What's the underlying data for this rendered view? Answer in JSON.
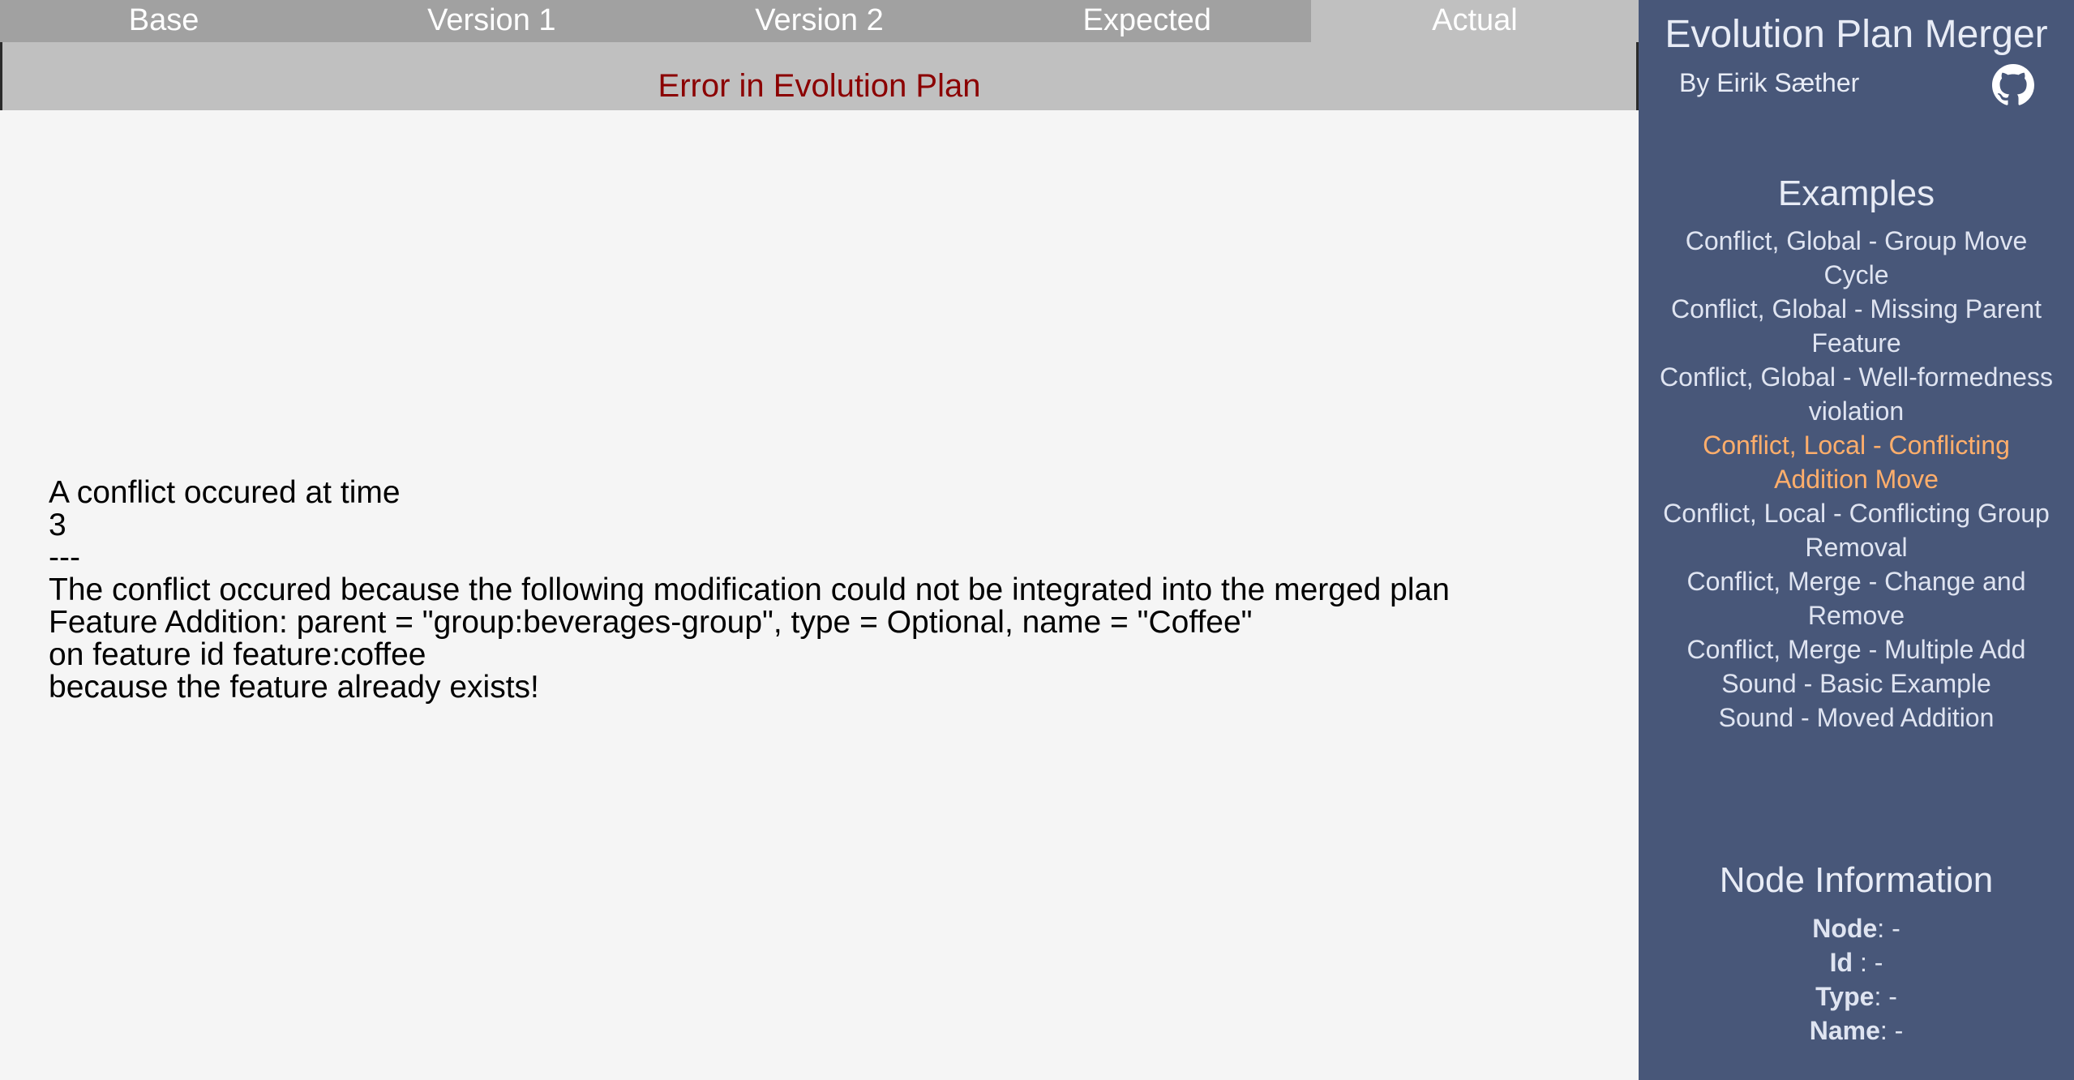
{
  "tabs": [
    {
      "label": "Base"
    },
    {
      "label": "Version 1"
    },
    {
      "label": "Version 2"
    },
    {
      "label": "Expected"
    },
    {
      "label": "Actual",
      "active": true
    }
  ],
  "error": {
    "title": "Error in Evolution Plan",
    "lines": [
      "A conflict occured at time",
      "3",
      "---",
      "The conflict occured because the following modification could not be integrated into the merged plan",
      "Feature Addition: parent = \"group:beverages-group\", type = Optional, name = \"Coffee\"",
      "on feature id feature:coffee",
      "because the feature already exists!"
    ]
  },
  "sidebar": {
    "title": "Evolution Plan Merger",
    "author": "By Eirik Sæther",
    "github_icon": "github-icon",
    "examples_title": "Examples",
    "examples": [
      {
        "label": "Conflict, Global - Group Move Cycle"
      },
      {
        "label": "Conflict, Global - Missing Parent Feature"
      },
      {
        "label": "Conflict, Global - Well-formedness violation"
      },
      {
        "label": "Conflict, Local - Conflicting Addition Move",
        "selected": true
      },
      {
        "label": "Conflict, Local - Conflicting Group Removal"
      },
      {
        "label": "Conflict, Merge - Change and Remove"
      },
      {
        "label": "Conflict, Merge - Multiple Add"
      },
      {
        "label": "Sound - Basic Example"
      },
      {
        "label": "Sound - Moved Addition"
      }
    ],
    "node_info": {
      "title": "Node Information",
      "fields": [
        {
          "label": "Node",
          "sep": ": ",
          "value": "-"
        },
        {
          "label": "Id",
          "sep": " : ",
          "value": "-"
        },
        {
          "label": "Type",
          "sep": ": ",
          "value": "-"
        },
        {
          "label": "Name",
          "sep": ": ",
          "value": "-"
        }
      ]
    }
  },
  "colors": {
    "sidebar_bg": "#485779",
    "tab_bg": "#a1a1a1",
    "tab_active_bg": "#c0c0c0",
    "error_text": "#8b0000",
    "selected_example": "#ffae6b"
  }
}
